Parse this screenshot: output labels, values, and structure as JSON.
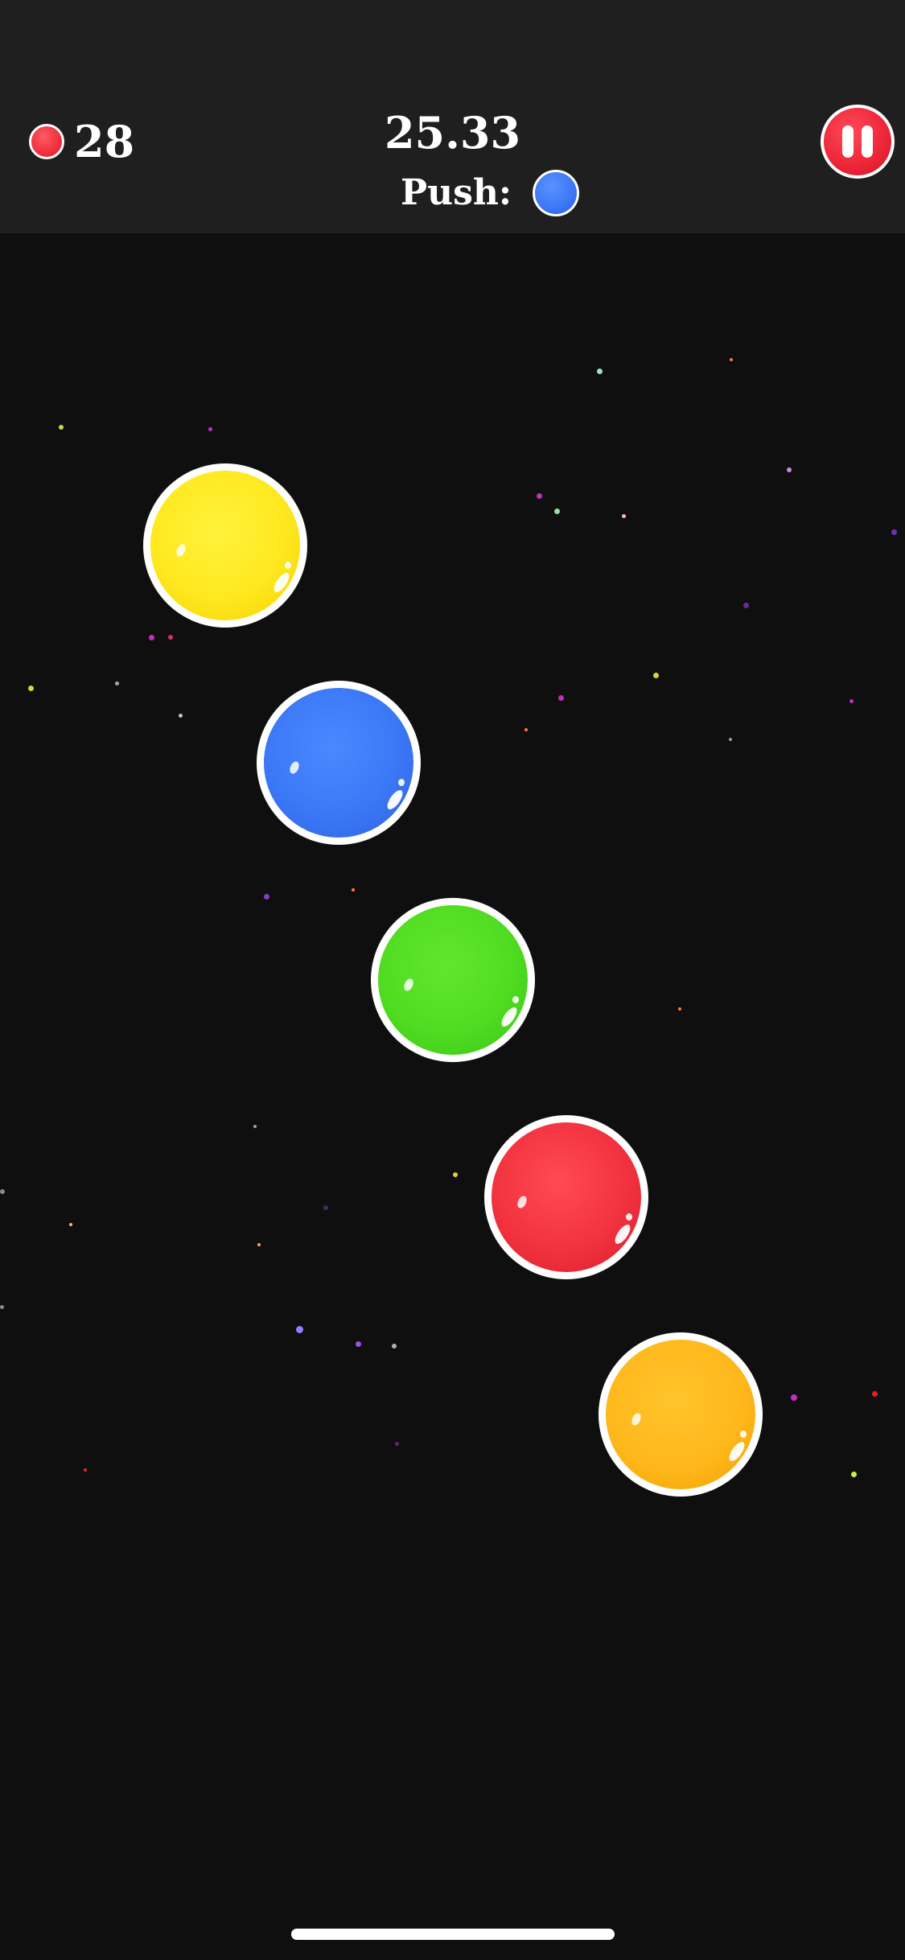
{
  "hud": {
    "lives_icon": "red-ball-icon",
    "lives_count": "28",
    "timer": "25.33",
    "push_label": "Push:",
    "push_ball_color": "blue",
    "pause_icon": "pause-icon"
  },
  "bubbles": [
    {
      "color_name": "yellow",
      "color": "#ffe81f"
    },
    {
      "color_name": "blue",
      "color": "#3b78f6"
    },
    {
      "color_name": "green",
      "color": "#50dc22"
    },
    {
      "color_name": "red",
      "color": "#f2323f"
    },
    {
      "color_name": "orange",
      "color": "#ffb81c"
    }
  ],
  "colors": {
    "background": "#0f0f0f",
    "top_bar": "#1f1f1f",
    "accent_red": "#ec2537"
  }
}
